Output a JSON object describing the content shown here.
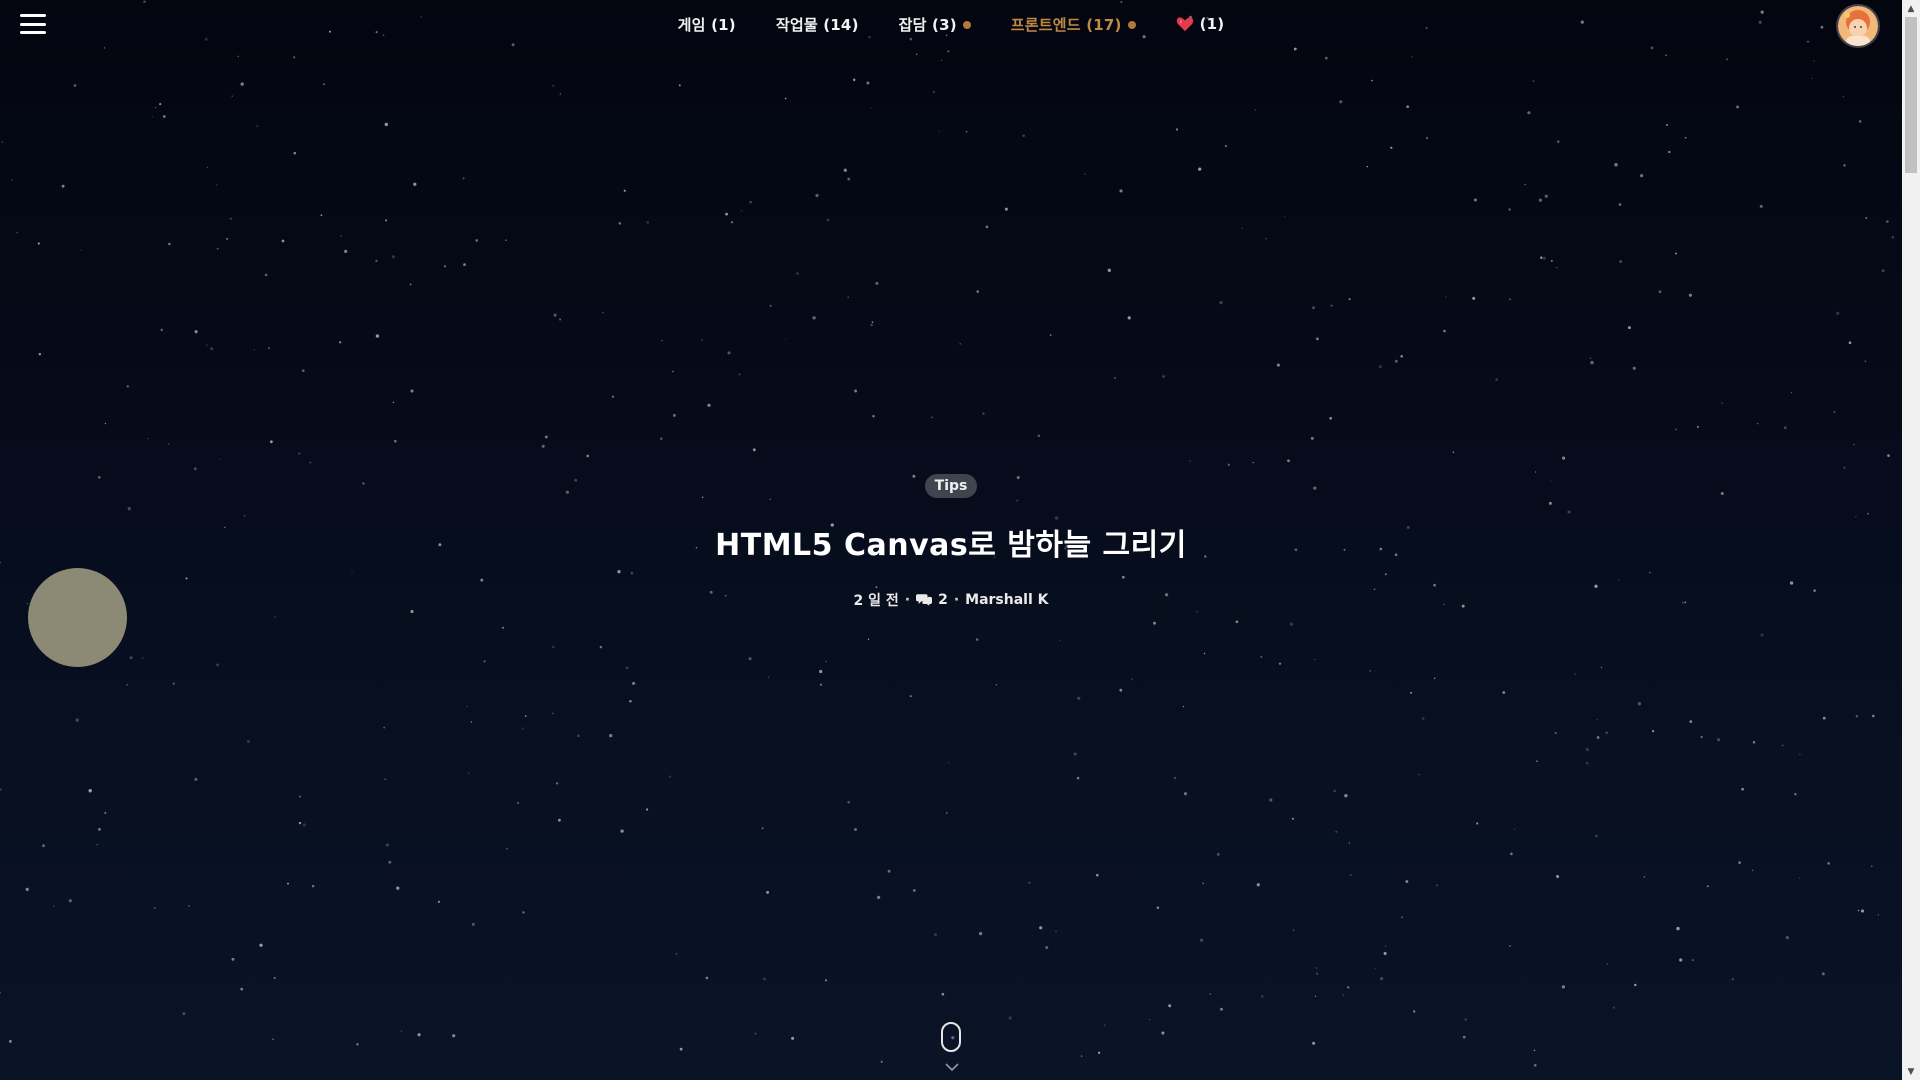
{
  "nav": {
    "items": [
      {
        "label": "게임 (1)",
        "active": false,
        "dot": false
      },
      {
        "label": "작업물 (14)",
        "active": false,
        "dot": false
      },
      {
        "label": "잡담 (3)",
        "active": false,
        "dot": true
      },
      {
        "label": "프론트엔드 (17)",
        "active": true,
        "dot": true
      },
      {
        "label": "(1)",
        "active": false,
        "dot": false,
        "icon": "heart-icon"
      }
    ]
  },
  "post": {
    "tag": "Tips",
    "title": "HTML5 Canvas로 밤하늘 그리기",
    "date": "2 일 전",
    "separator": "·",
    "comments": "2",
    "author": "Marshall K"
  },
  "colors": {
    "sky_top": "#03060f",
    "sky_bottom": "#0a1427",
    "moon": "#8c8a74",
    "accent": "#c08a45",
    "tag_bg": "#3e454f"
  },
  "icons": {
    "menu": "hamburger-menu-icon",
    "avatar": "user-avatar",
    "scroll": "mouse-scroll-icon"
  }
}
